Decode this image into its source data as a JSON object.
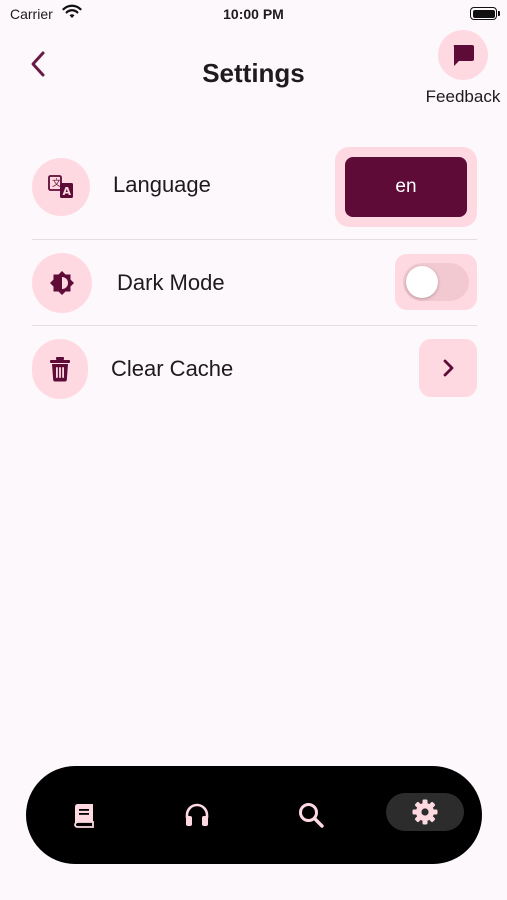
{
  "status_bar": {
    "carrier": "Carrier",
    "time": "10:00 PM"
  },
  "header": {
    "title": "Settings",
    "feedback_label": "Feedback"
  },
  "settings": {
    "language": {
      "label": "Language",
      "value": "en"
    },
    "dark_mode": {
      "label": "Dark Mode",
      "enabled": false
    },
    "clear_cache": {
      "label": "Clear Cache"
    }
  },
  "bottom_nav": {
    "items": [
      {
        "icon": "book-icon",
        "active": false
      },
      {
        "icon": "headphones-icon",
        "active": false
      },
      {
        "icon": "search-icon",
        "active": false
      },
      {
        "icon": "gear-icon",
        "active": true
      }
    ]
  },
  "colors": {
    "background": "#fdf8fb",
    "accent_dark": "#5e0b37",
    "accent_light": "#ffd9e2",
    "nav_icon": "#ffd9e2",
    "nav_background": "#000000"
  }
}
